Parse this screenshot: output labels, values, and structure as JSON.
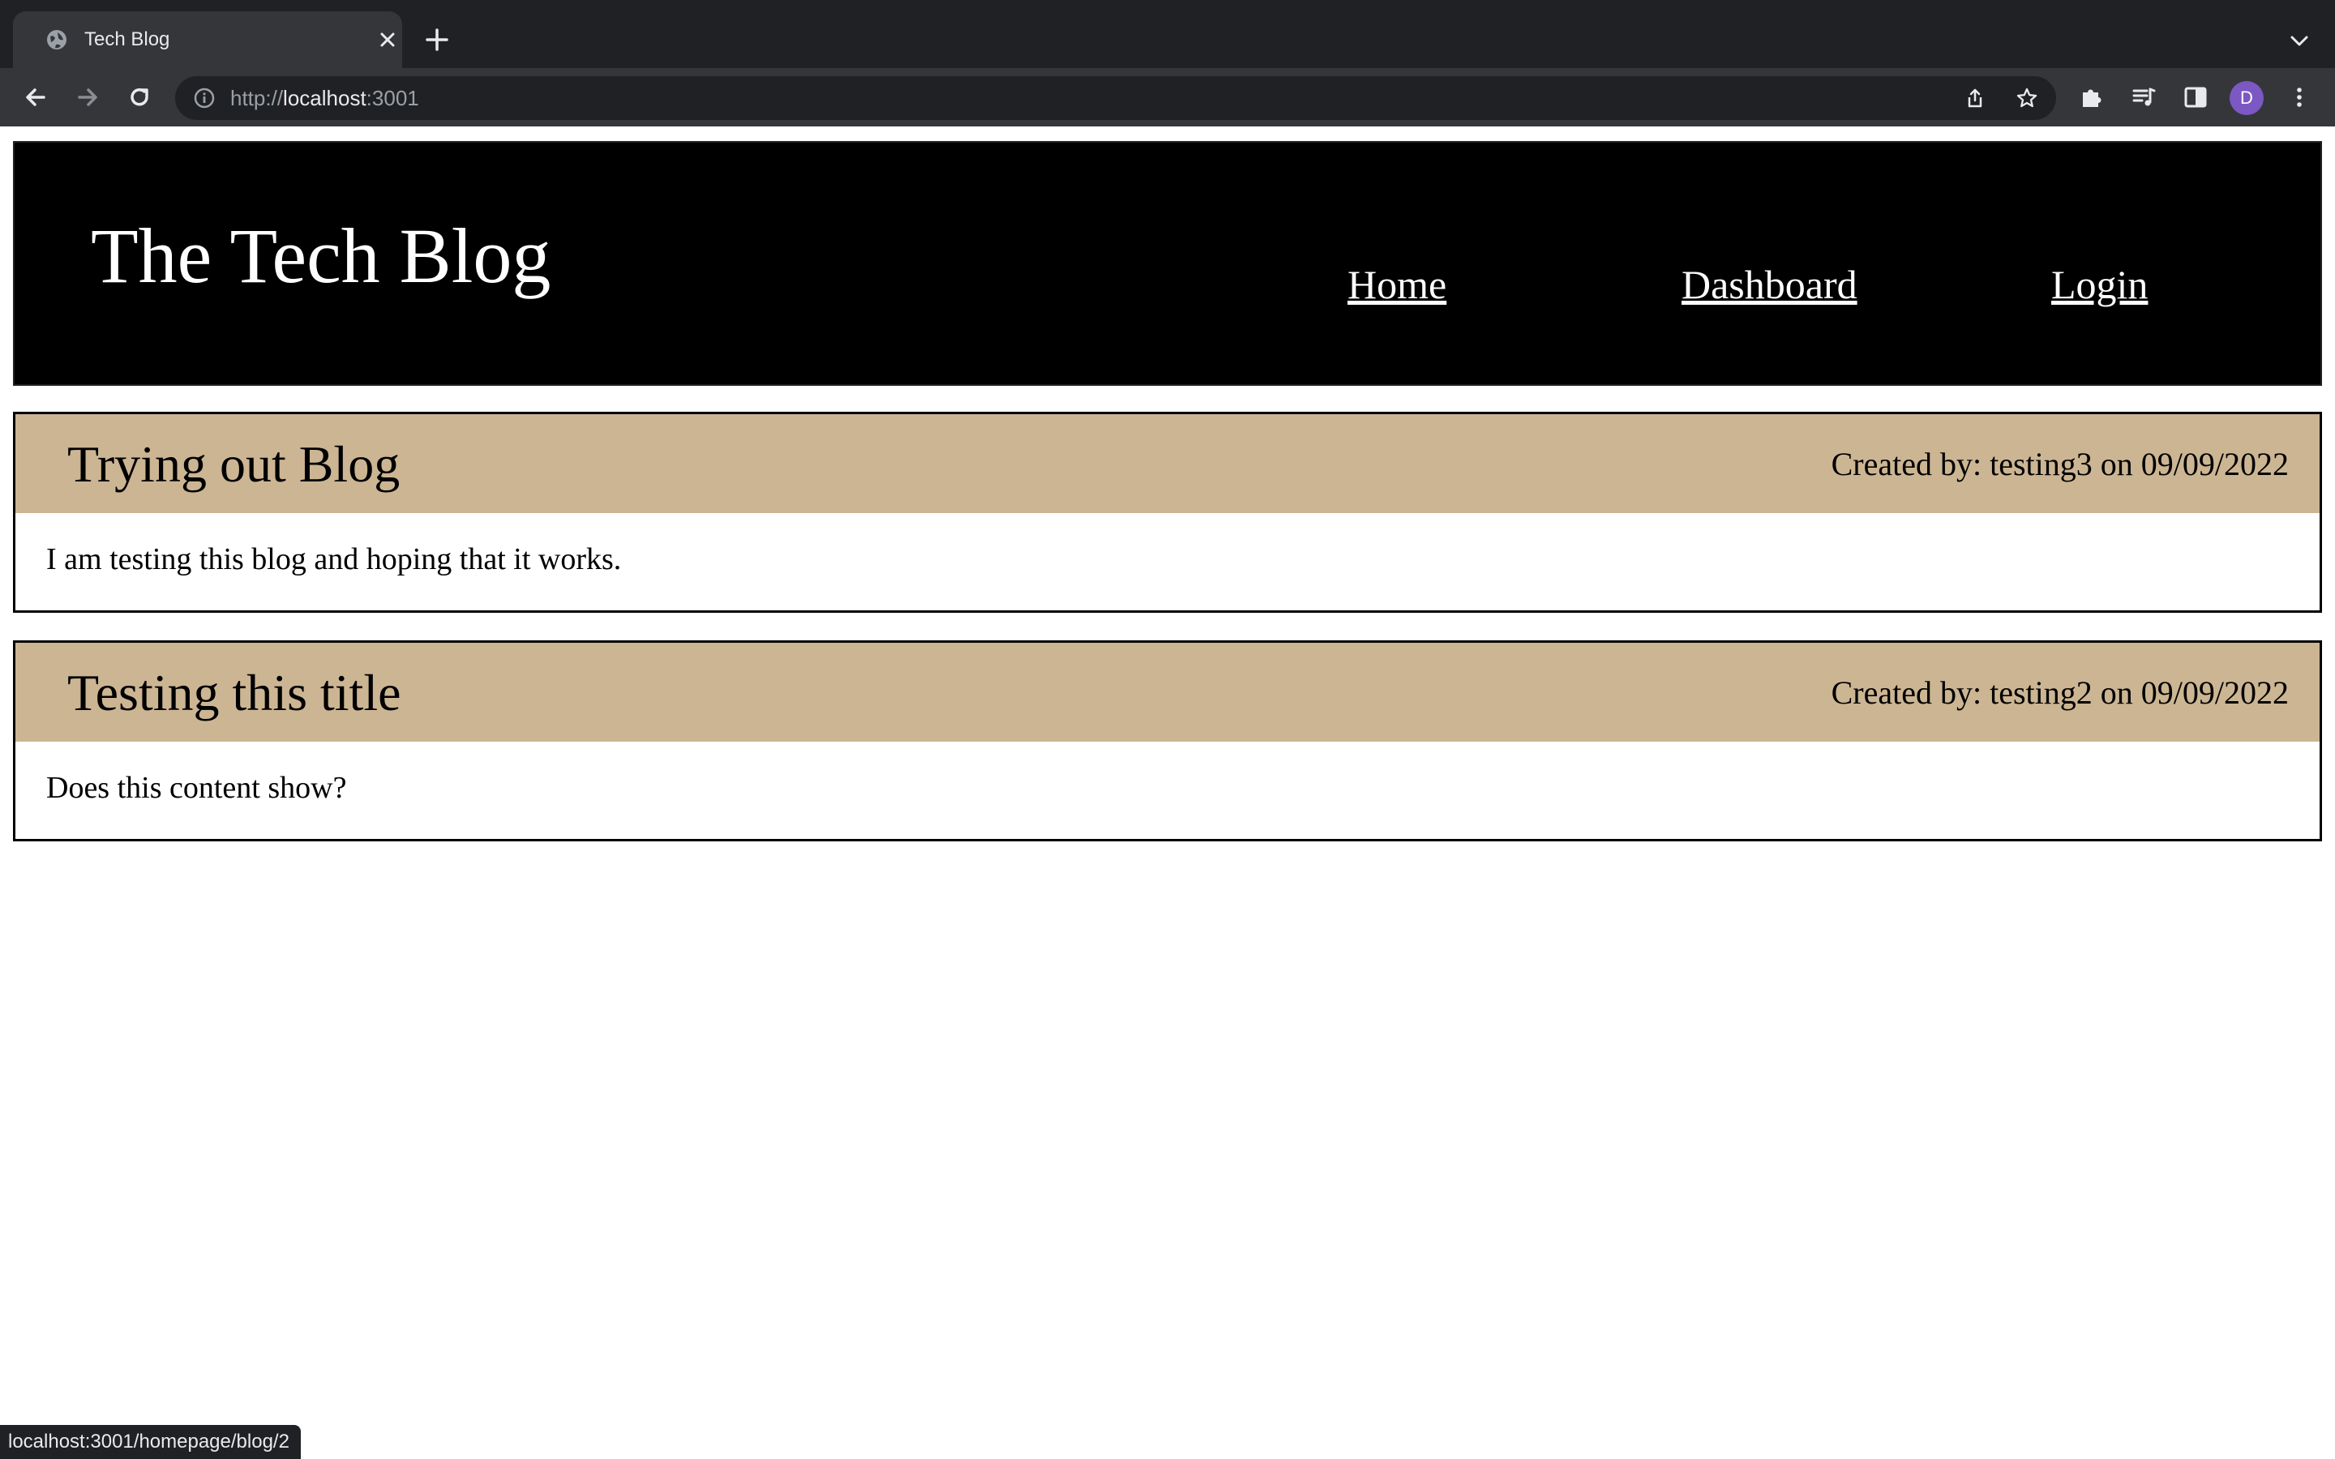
{
  "browser": {
    "tab_title": "Tech Blog",
    "url_scheme": "http://",
    "url_host": "localhost",
    "url_port": ":3001",
    "profile_initial": "D",
    "status_url": "localhost:3001/homepage/blog/2",
    "icons": [
      "globe-icon",
      "close-icon",
      "plus-icon",
      "chevron-down-icon",
      "back-arrow-icon",
      "forward-arrow-icon",
      "reload-icon",
      "info-icon",
      "share-icon",
      "star-icon",
      "puzzle-icon",
      "media-queue-icon",
      "side-panel-icon",
      "kebab-menu-icon"
    ],
    "accent_colors": {
      "chrome_dark": "#202124",
      "chrome_toolbar": "#35363a",
      "avatar": "#7b58c2"
    }
  },
  "site": {
    "title": "The Tech Blog",
    "nav": {
      "home": "Home",
      "dashboard": "Dashboard",
      "login": "Login"
    },
    "colors": {
      "header_bg": "#000000",
      "post_head_bg": "#ccb593"
    }
  },
  "posts": [
    {
      "title": "Trying out Blog",
      "meta": "Created by: testing3 on 09/09/2022",
      "body": "I am testing this blog and hoping that it works."
    },
    {
      "title": "Testing this title",
      "meta": "Created by: testing2 on 09/09/2022",
      "body": "Does this content show?"
    }
  ]
}
